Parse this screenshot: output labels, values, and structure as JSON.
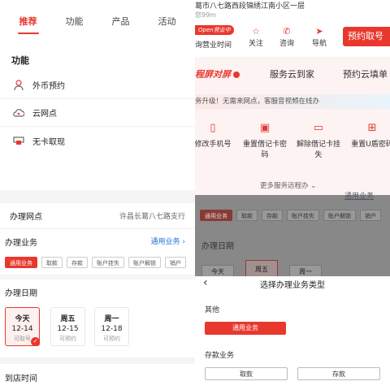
{
  "left": {
    "tabs": [
      "推荐",
      "功能",
      "产品",
      "活动"
    ],
    "func_title": "功能",
    "func_items": [
      {
        "label": "外币预约",
        "icon": "person-coin-icon"
      },
      {
        "label": "云网点",
        "icon": "cloud-icon"
      },
      {
        "label": "无卡取现",
        "icon": "atm-icon"
      }
    ],
    "branch_label": "办理网点",
    "branch_value": "许昌长葛八七路支行",
    "business_label": "办理业务",
    "business_value": "通用业务",
    "business_chips": [
      "通用业务",
      "取款",
      "存款",
      "账户挂失",
      "账户解锁",
      "销户"
    ],
    "date_label": "办理日期",
    "days": [
      {
        "day": "今天",
        "date": "12-14",
        "status": "可取号"
      },
      {
        "day": "周五",
        "date": "12-15",
        "status": "可预约"
      },
      {
        "day": "周一",
        "date": "12-18",
        "status": "可预约"
      }
    ],
    "arrive_label": "到店时间"
  },
  "right": {
    "address": "葛市八七路西段锦绣江南小区一层",
    "distance": "您99m",
    "open_badge": "Open营业中",
    "hours": "询营业时间",
    "actions": [
      "关注",
      "咨询",
      "导航"
    ],
    "book_button": "预约取号",
    "banner_tabs": [
      "程屏对屏",
      "服务云到家",
      "预约云填单"
    ],
    "notice": "务升级！无需来网点，客服音视频在线办",
    "services": [
      "修改手机号",
      "重置借记卡密码",
      "解除借记卡挂失",
      "重置U盾密码"
    ],
    "more": "更多服务远程办",
    "bg_chips": [
      "通用业务",
      "取款",
      "存款",
      "账户挂失",
      "账户解锁",
      "销户"
    ],
    "bg_date": "办理日期",
    "bg_days": [
      "今天",
      "周五",
      "周一"
    ],
    "bg_link": "通用业务",
    "sheet_title": "选择办理业务类型",
    "other_label": "其他",
    "other_option": "通用业务",
    "deposit_label": "存款业务",
    "deposit_options": [
      "取款",
      "存款"
    ]
  },
  "colors": {
    "accent": "#e8382e",
    "bg": "#f5f5f5"
  }
}
